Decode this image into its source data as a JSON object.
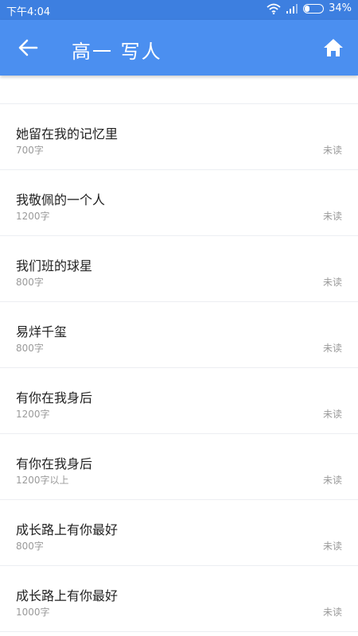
{
  "status_bar": {
    "time": "下午4:04",
    "battery_text": "34%",
    "battery_level": 0.34,
    "icons": [
      "wifi-icon",
      "signal-icon",
      "battery-icon"
    ]
  },
  "header": {
    "title": "高一 写人",
    "back_icon": "back-arrow-icon",
    "home_icon": "home-icon"
  },
  "essays": [
    {
      "title": "",
      "count": "",
      "status": ""
    },
    {
      "title": "她留在我的记忆里",
      "count": "700字",
      "status": "未读"
    },
    {
      "title": "我敬佩的一个人",
      "count": "1200字",
      "status": "未读"
    },
    {
      "title": "我们班的球星",
      "count": "800字",
      "status": "未读"
    },
    {
      "title": "易烊千玺",
      "count": "800字",
      "status": "未读"
    },
    {
      "title": "有你在我身后",
      "count": "1200字",
      "status": "未读"
    },
    {
      "title": "有你在我身后",
      "count": "1200字以上",
      "status": "未读"
    },
    {
      "title": "成长路上有你最好",
      "count": "800字",
      "status": "未读"
    },
    {
      "title": "成长路上有你最好",
      "count": "1000字",
      "status": "未读"
    }
  ],
  "colors": {
    "status_bar": "#3d7fe0",
    "app_bar": "#4b8ff0",
    "title_text": "#222222",
    "meta_text": "#9a9a9a"
  }
}
